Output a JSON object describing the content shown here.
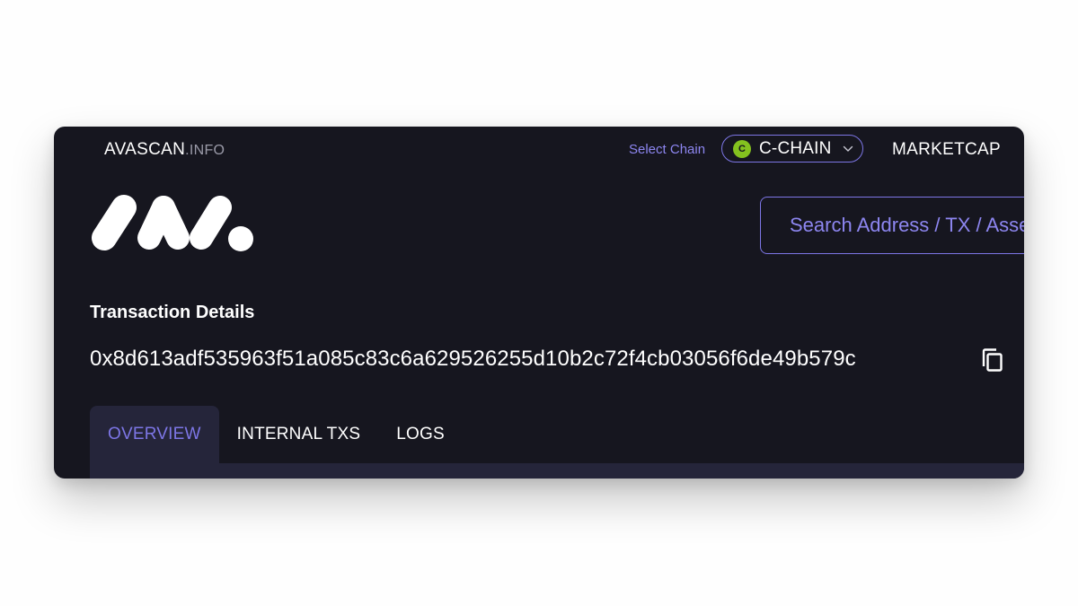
{
  "header": {
    "brand_name": "AVASCAN",
    "brand_suffix": ".INFO",
    "select_chain_label": "Select Chain",
    "chain": {
      "badge": "C",
      "label": "C-CHAIN",
      "badge_color": "#84c11f"
    },
    "marketcap_label": "MARKETCAP"
  },
  "search": {
    "placeholder": "Search Address / TX / Asset"
  },
  "page": {
    "title": "Transaction Details",
    "tx_hash": "0x8d613adf535963f51a085c83c6a629526255d10b2c72f4cb03056f6de49b579c"
  },
  "tabs": [
    {
      "label": "OVERVIEW",
      "active": true
    },
    {
      "label": "INTERNAL TXS",
      "active": false
    },
    {
      "label": "LOGS",
      "active": false
    }
  ],
  "icons": {
    "logo": "avascan-logo",
    "chevron": "chevron-down-icon",
    "copy": "copy-icon"
  },
  "colors": {
    "background": "#16161f",
    "accent": "#7d76e6",
    "tab_active_bg": "#25253a"
  }
}
